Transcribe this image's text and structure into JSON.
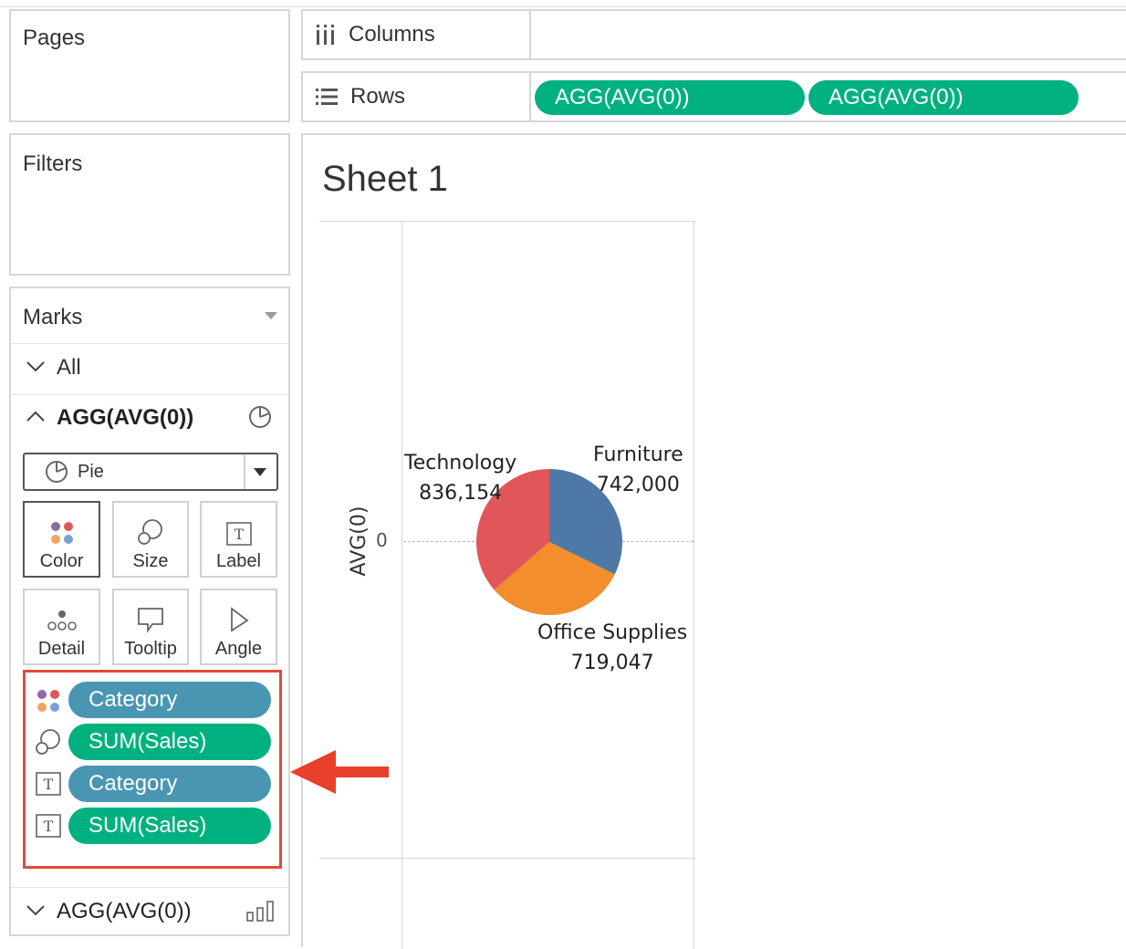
{
  "pages_panel": {
    "title": "Pages"
  },
  "filters_panel": {
    "title": "Filters"
  },
  "columns_shelf": {
    "label": "Columns"
  },
  "rows_shelf": {
    "label": "Rows",
    "pills": [
      "AGG(AVG(0))",
      "AGG(AVG(0))"
    ]
  },
  "marks": {
    "title": "Marks",
    "all_label": "All",
    "layer1": {
      "label": "AGG(AVG(0))",
      "mark_type": "Pie"
    },
    "cards": [
      "Color",
      "Size",
      "Label",
      "Detail",
      "Tooltip",
      "Angle"
    ],
    "fields": [
      {
        "icon": "color-icon",
        "label": "Category",
        "kind": "blue"
      },
      {
        "icon": "size-icon",
        "label": "SUM(Sales)",
        "kind": "green"
      },
      {
        "icon": "label-icon",
        "label": "Category",
        "kind": "blue"
      },
      {
        "icon": "label-icon",
        "label": "SUM(Sales)",
        "kind": "green"
      }
    ],
    "layer2": {
      "label": "AGG(AVG(0))"
    }
  },
  "sheet": {
    "title": "Sheet 1",
    "axis_label": "AVG(0)",
    "axis_tick": "0"
  },
  "colors": {
    "green_pill": "#00b180",
    "blue_pill": "#4996b2",
    "highlight": "#e04b3a"
  },
  "chart_data": {
    "type": "pie",
    "categories": [
      "Furniture",
      "Office Supplies",
      "Technology"
    ],
    "values": [
      742000,
      719047,
      836154
    ],
    "value_labels": [
      "742,000",
      "719,047",
      "836,154"
    ],
    "colors": [
      "#4e79a7",
      "#f28e2b",
      "#e15759"
    ]
  }
}
